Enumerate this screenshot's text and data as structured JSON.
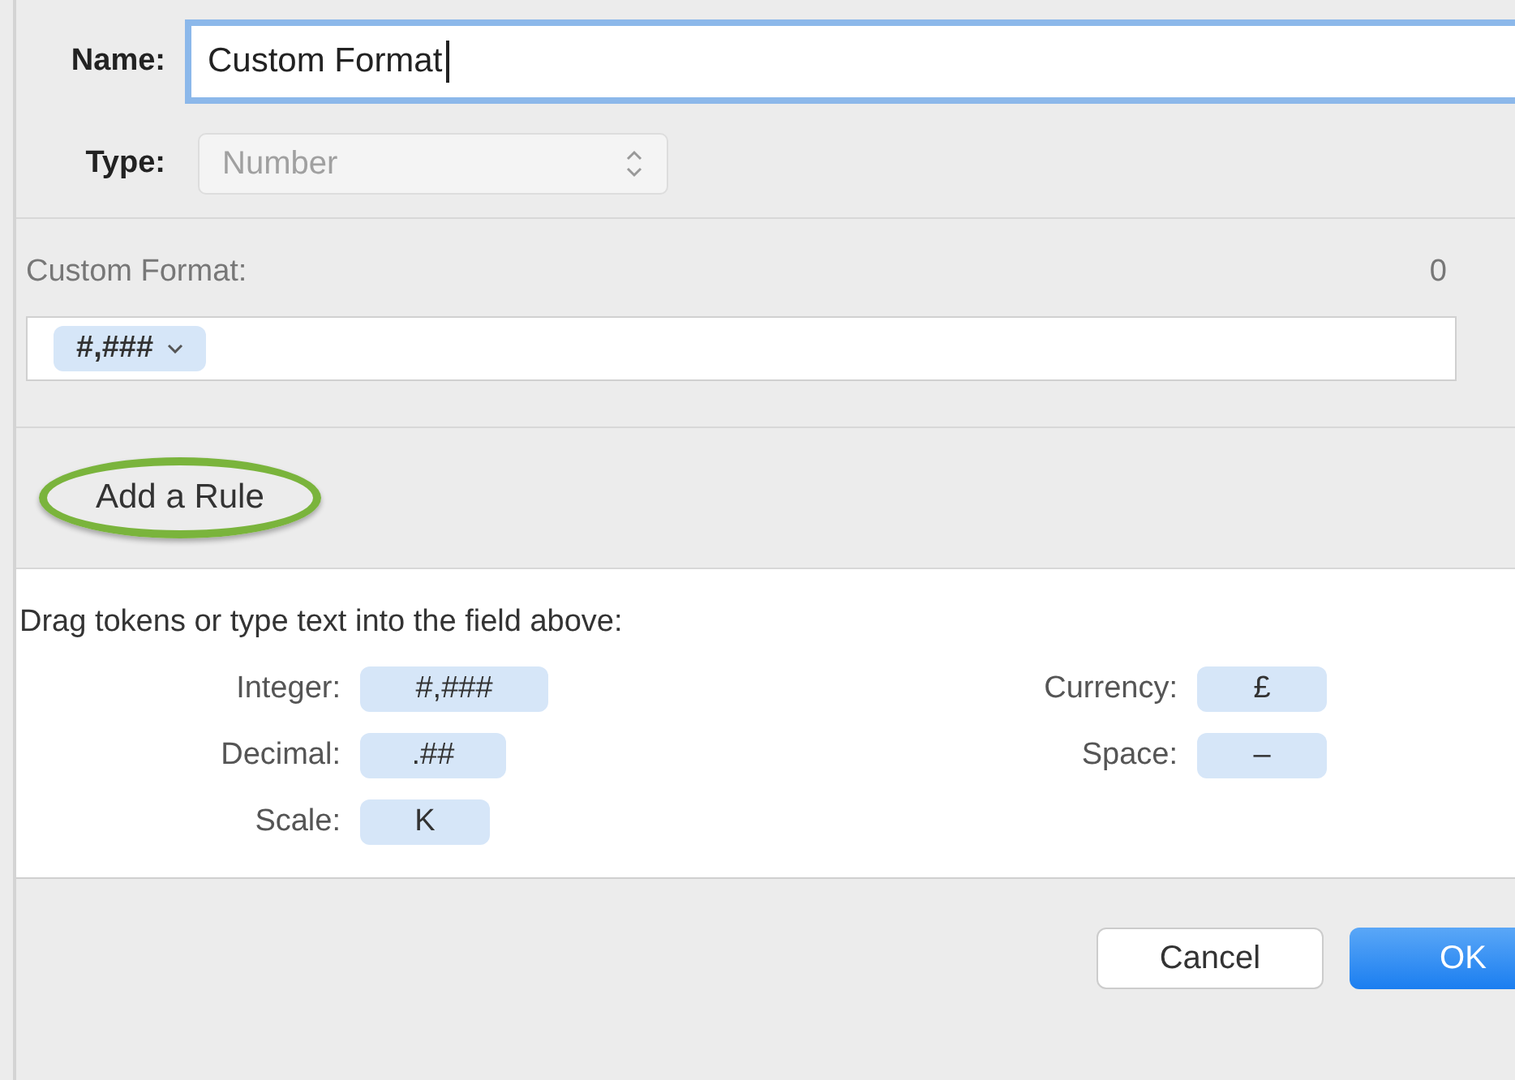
{
  "name_field": {
    "label": "Name:",
    "value": "Custom Format",
    "focused": true
  },
  "type_field": {
    "label": "Type:",
    "value": "Number",
    "disabled": true
  },
  "custom_format": {
    "label": "Custom Format:",
    "count": "0",
    "tokens": [
      {
        "text": "#,###",
        "menu": true
      }
    ]
  },
  "add_rule": {
    "label": "Add a Rule",
    "highlighted": true
  },
  "palette": {
    "hint": "Drag tokens or type text into the field above:",
    "columns": [
      [
        {
          "label": "Integer:",
          "token": "#,###"
        },
        {
          "label": "Decimal:",
          "token": ".##"
        },
        {
          "label": "Scale:",
          "token": "K"
        }
      ],
      [
        {
          "label": "Currency:",
          "token": "£"
        },
        {
          "label": "Space:",
          "token": "–"
        }
      ]
    ]
  },
  "buttons": [
    {
      "label": "Cancel",
      "kind": "secondary"
    },
    {
      "label": "OK",
      "kind": "primary"
    }
  ]
}
